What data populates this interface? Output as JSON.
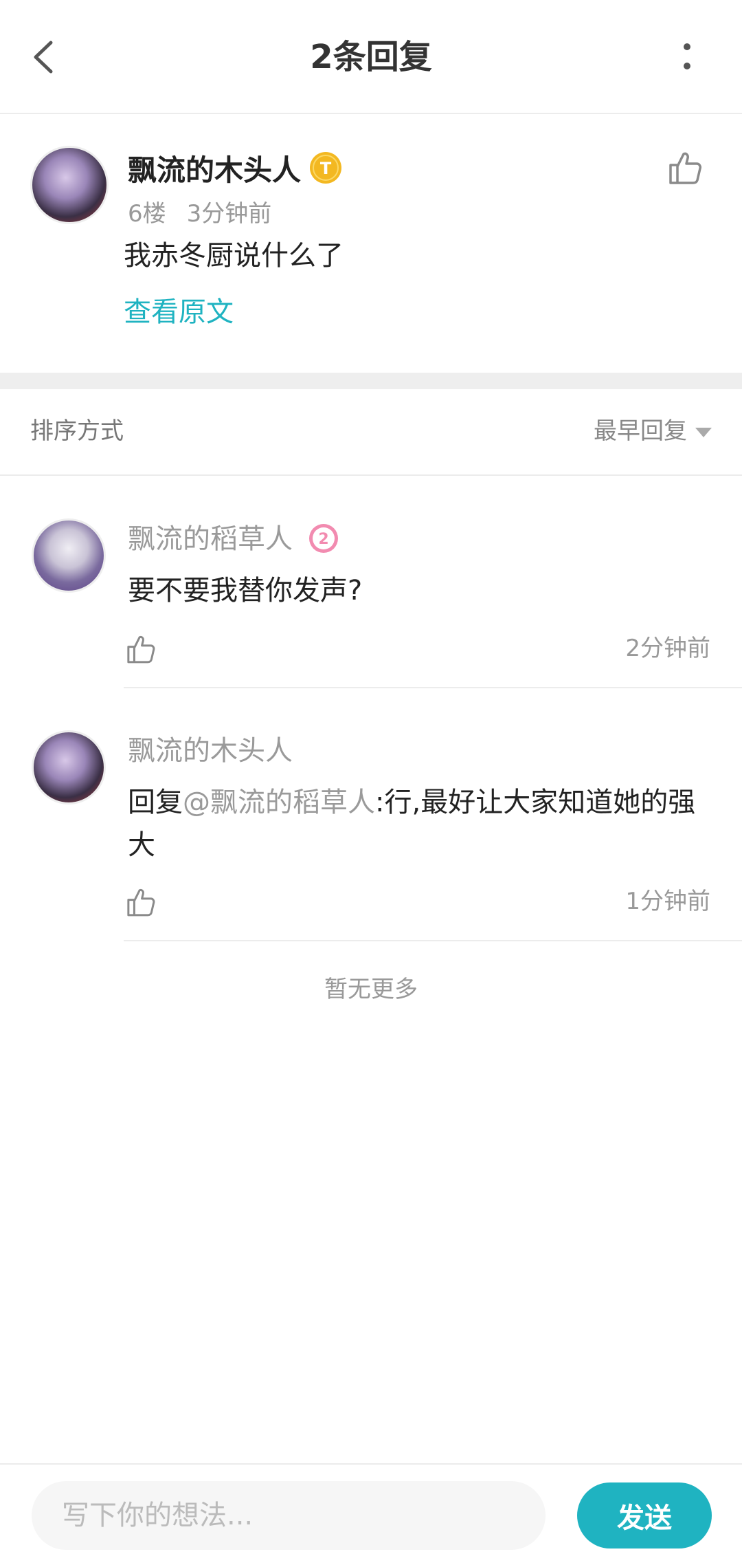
{
  "header": {
    "title": "2条回复"
  },
  "main_comment": {
    "author": "飘流的木头人",
    "badge": "T",
    "floor": "6楼",
    "time": "3分钟前",
    "text": "我赤冬厨说什么了",
    "view_original": "查看原文"
  },
  "sort": {
    "label": "排序方式",
    "selected": "最早回复"
  },
  "replies": [
    {
      "author": "飘流的稻草人",
      "badge": "2",
      "text": "要不要我替你发声?",
      "time": "2分钟前"
    },
    {
      "author": "飘流的木头人",
      "reply_prefix": "回复",
      "mention": "@飘流的稻草人",
      "text": ":行,最好让大家知道她的强大",
      "time": "1分钟前"
    }
  ],
  "footer": {
    "no_more": "暂无更多"
  },
  "composer": {
    "placeholder": "写下你的想法...",
    "send_label": "发送"
  },
  "colors": {
    "accent": "#1fb3c1",
    "badge_gold": "#f3b821",
    "badge_pink": "#f28bb0"
  }
}
